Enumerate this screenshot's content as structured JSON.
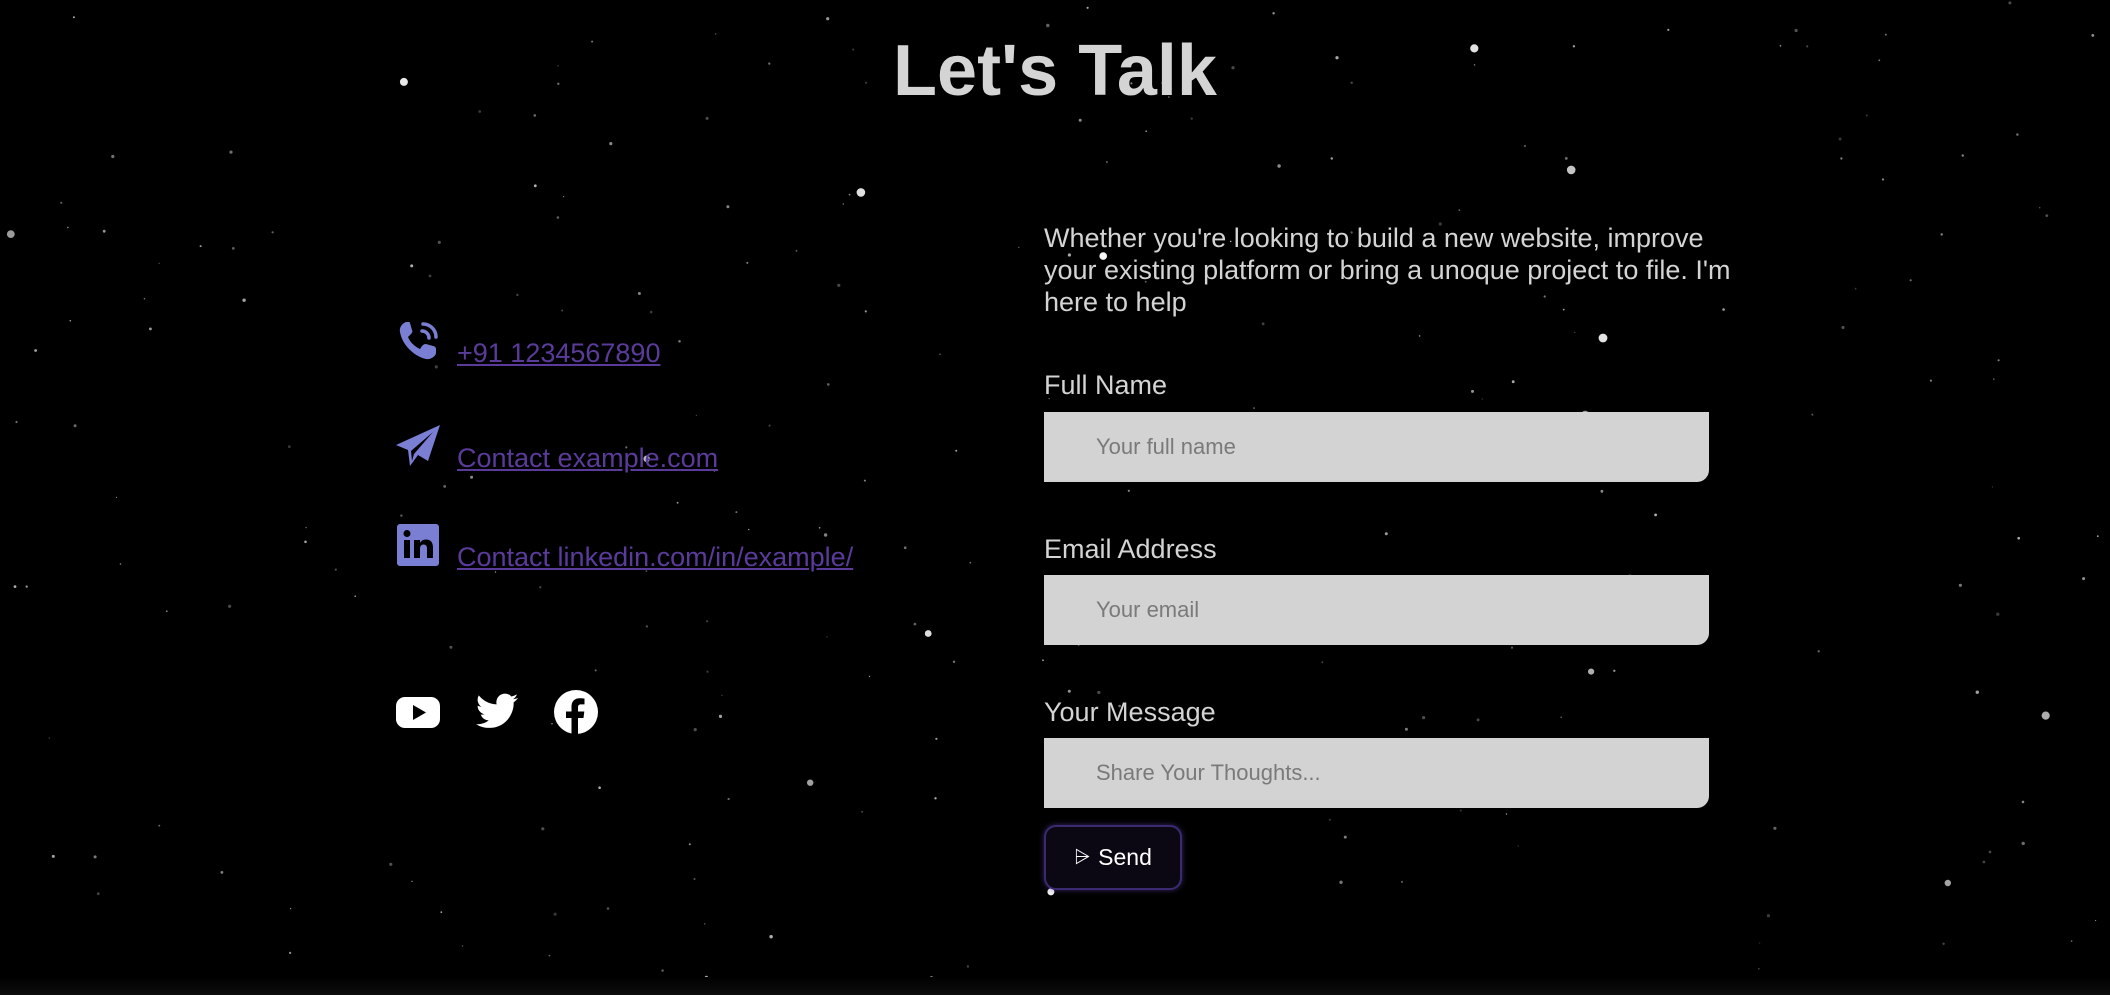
{
  "title": "Let's Talk",
  "contact": {
    "phone": "+91 1234567890",
    "email": "Contact example.com",
    "linkedin": "Contact linkedin.com/in/example/"
  },
  "social_icons": [
    "youtube-icon",
    "twitter-icon",
    "facebook-icon"
  ],
  "intro": "Whether you're looking to build a new website, improve your existing platform or bring a unoque project to file. I'm here to help",
  "form": {
    "name_label": "Full Name",
    "name_placeholder": "Your full name",
    "email_label": "Email Address",
    "email_placeholder": "Your email",
    "message_label": "Your Message",
    "message_placeholder": "Share Your Thoughts...",
    "send_icon": "⩥",
    "send_label": "Send"
  },
  "colors": {
    "background": "#000000",
    "heading": "#d4d4d4",
    "icon_accent": "#7b7fd4",
    "link": "#5a3b9a",
    "input_bg": "#d3d3d3",
    "button_border": "#3b2a72"
  }
}
